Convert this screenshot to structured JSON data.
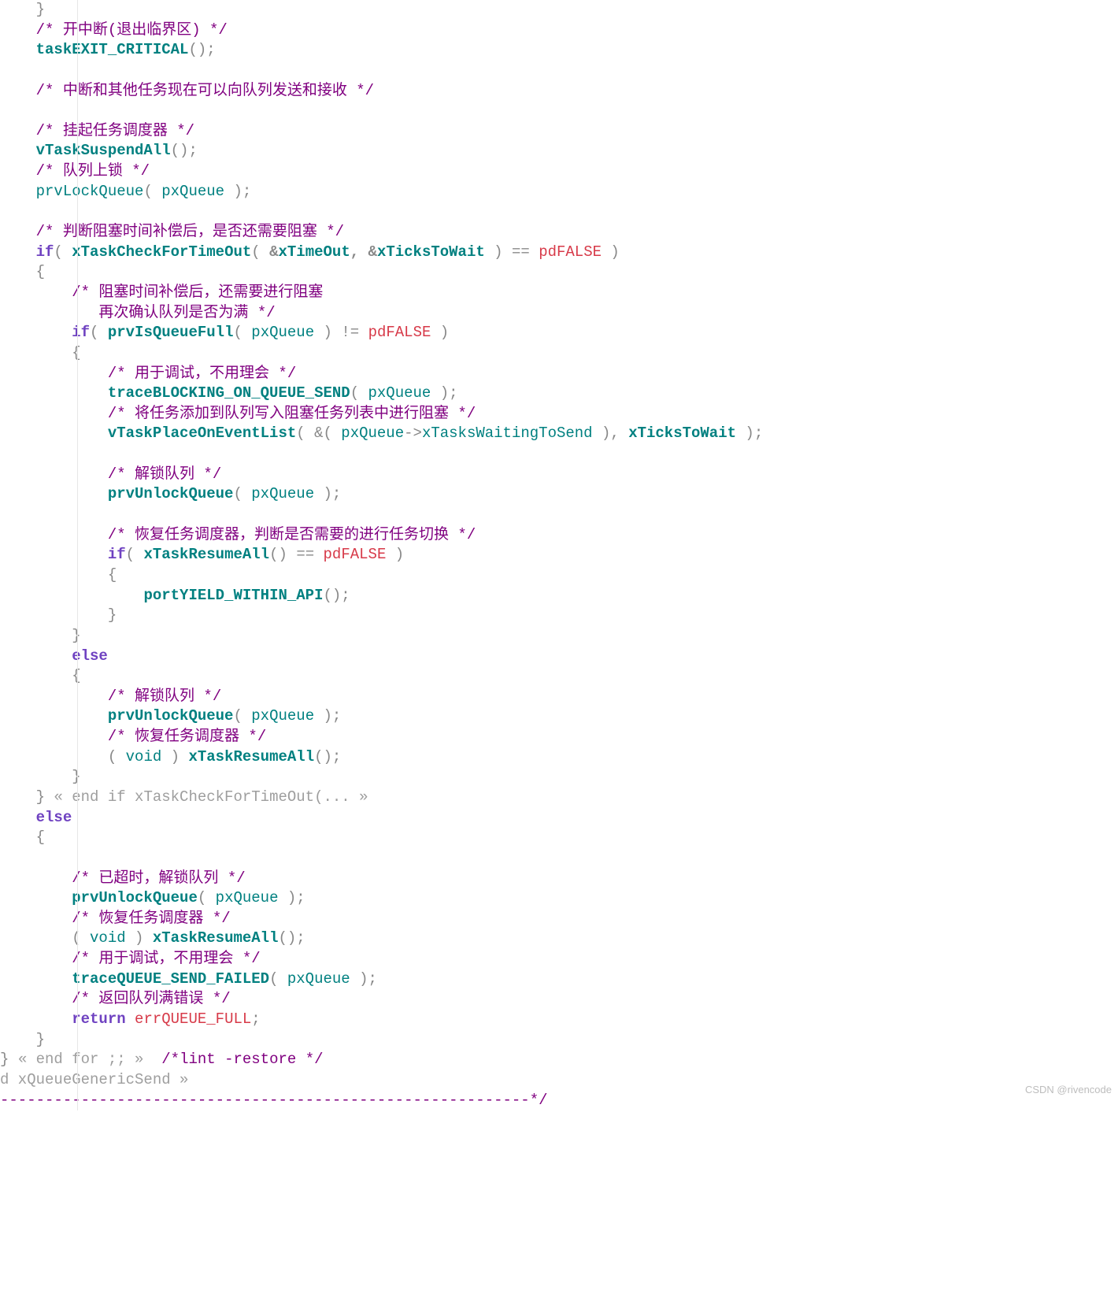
{
  "watermark": "CSDN @rivencode",
  "lines": {
    "pad": "    ",
    "l0": "}",
    "l1_c": "/* 开中断(退出临界区) */",
    "l2_fn": "taskEXIT_CRITICAL",
    "l2_tail": "();",
    "l4_c": "/* 中断和其他任务现在可以向队列发送和接收 */",
    "l6_c": "/* 挂起任务调度器 */",
    "l7_fn": "vTaskSuspendAll",
    "l7_tail": "();",
    "l8_c": "/* 队列上锁 */",
    "l9_fn": "prvLockQueue",
    "l9_arg": "pxQueue",
    "l11_c": "/* 判断阻塞时间补偿后，是否还需要阻塞 */",
    "l12_kw": "if",
    "l12_fn": "xTaskCheckForTimeOut",
    "l12_a1": "xTimeOut",
    "l12_a2": "xTicksToWait",
    "l12_eq": "==",
    "l12_v": "pdFALSE",
    "l14_c1": "/* 阻塞时间补偿后，还需要进行阻塞",
    "l14_c2": "   再次确认队列是否为满 */",
    "l15_kw": "if",
    "l15_fn": "prvIsQueueFull",
    "l15_arg": "pxQueue",
    "l15_ne": "!=",
    "l15_v": "pdFALSE",
    "l17_c": "/* 用于调试，不用理会 */",
    "l18_fn": "traceBLOCKING_ON_QUEUE_SEND",
    "l18_arg": "pxQueue",
    "l19_c": "/* 将任务添加到队列写入阻塞任务列表中进行阻塞 */",
    "l20_fn": "vTaskPlaceOnEventList",
    "l20_px": "pxQueue",
    "l20_mem": "xTasksWaitingToSend",
    "l20_a2": "xTicksToWait",
    "l22_c": "/* 解锁队列 */",
    "l23_fn": "prvUnlockQueue",
    "l23_arg": "pxQueue",
    "l25_c": "/* 恢复任务调度器，判断是否需要的进行任务切换 */",
    "l26_kw": "if",
    "l26_fn": "xTaskResumeAll",
    "l26_eq": "==",
    "l26_v": "pdFALSE",
    "l28_fn": "portYIELD_WITHIN_API",
    "l31_kw": "else",
    "l33_c": "/* 解锁队列 */",
    "l34_fn": "prvUnlockQueue",
    "l34_arg": "pxQueue",
    "l35_c": "/* 恢复任务调度器 */",
    "l36_void": "void",
    "l36_fn": "xTaskResumeAll",
    "l38_fold": "« end if xTaskCheckForTimeOut(... »",
    "l39_kw": "else",
    "l42_c": "/* 已超时，解锁队列 */",
    "l43_fn": "prvUnlockQueue",
    "l43_arg": "pxQueue",
    "l44_c": "/* 恢复任务调度器 */",
    "l45_void": "void",
    "l45_fn": "xTaskResumeAll",
    "l46_c": "/* 用于调试，不用理会 */",
    "l47_fn": "traceQUEUE_SEND_FAILED",
    "l47_arg": "pxQueue",
    "l48_c": "/* 返回队列满错误 */",
    "l49_kw": "return",
    "l49_v": "errQUEUE_FULL",
    "l51_fold": "« end for ;; »",
    "l51_c": "/*lint -restore */",
    "l52_fold": "d xQueueGenericSend »",
    "l53_a": "-----------------------------------------------------------*/"
  }
}
